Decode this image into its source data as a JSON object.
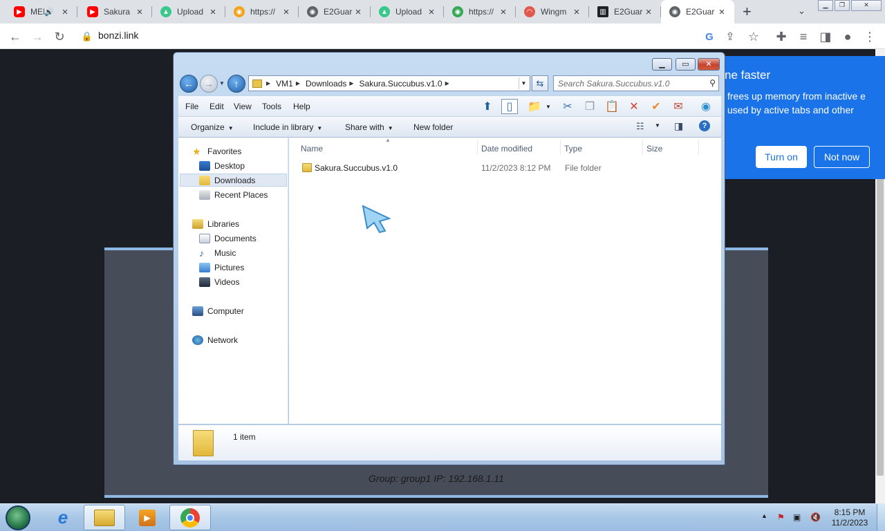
{
  "browser": {
    "tabs": [
      {
        "label": "MEI",
        "favicon": "youtube-icon",
        "color": "#ff0000",
        "audio": true
      },
      {
        "label": "Sakura",
        "favicon": "youtube-icon",
        "color": "#ff0000"
      },
      {
        "label": "Upload",
        "favicon": "upload-icon",
        "color": "#38c98a"
      },
      {
        "label": "https://",
        "favicon": "globe-icon",
        "color": "#f4a21a"
      },
      {
        "label": "E2Guar",
        "favicon": "globe-icon",
        "color": "#5f6368"
      },
      {
        "label": "Upload",
        "favicon": "upload-icon",
        "color": "#38c98a"
      },
      {
        "label": "https://",
        "favicon": "globe-icon",
        "color": "#34a853"
      },
      {
        "label": "Wingm",
        "favicon": "rainbow-icon",
        "color": "#e2574c"
      },
      {
        "label": "E2Guar",
        "favicon": "building-icon",
        "color": "#202124"
      },
      {
        "label": "E2Guar",
        "favicon": "globe-icon",
        "color": "#5f6368",
        "active": true
      }
    ],
    "url": "bonzi.link"
  },
  "popup": {
    "title": "ne faster",
    "body": "frees up memory from inactive e used by active tabs and other",
    "turn_on": "Turn on",
    "not_now": "Not now",
    "accent": "#1a73e8"
  },
  "explorer": {
    "breadcrumb": [
      "VM1",
      "Downloads",
      "Sakura.Succubus.v1.0"
    ],
    "search_placeholder": "Search Sakura.Succubus.v1.0",
    "menu": [
      "File",
      "Edit",
      "View",
      "Tools",
      "Help"
    ],
    "commands": {
      "organize": "Organize",
      "include": "Include in library",
      "share": "Share with",
      "newfolder": "New folder"
    },
    "nav": {
      "favorites": "Favorites",
      "desktop": "Desktop",
      "downloads": "Downloads",
      "recent": "Recent Places",
      "libraries": "Libraries",
      "documents": "Documents",
      "music": "Music",
      "pictures": "Pictures",
      "videos": "Videos",
      "computer": "Computer",
      "network": "Network"
    },
    "columns": {
      "name": "Name",
      "date": "Date modified",
      "type": "Type",
      "size": "Size"
    },
    "files": [
      {
        "name": "Sakura.Succubus.v1.0",
        "date": "11/2/2023 8:12 PM",
        "type": "File folder",
        "size": ""
      }
    ],
    "status": "1 item"
  },
  "page": {
    "status": "Group: group1   IP: 192.168.1.11"
  },
  "taskbar": {
    "time": "8:15 PM",
    "date": "11/2/2023"
  }
}
